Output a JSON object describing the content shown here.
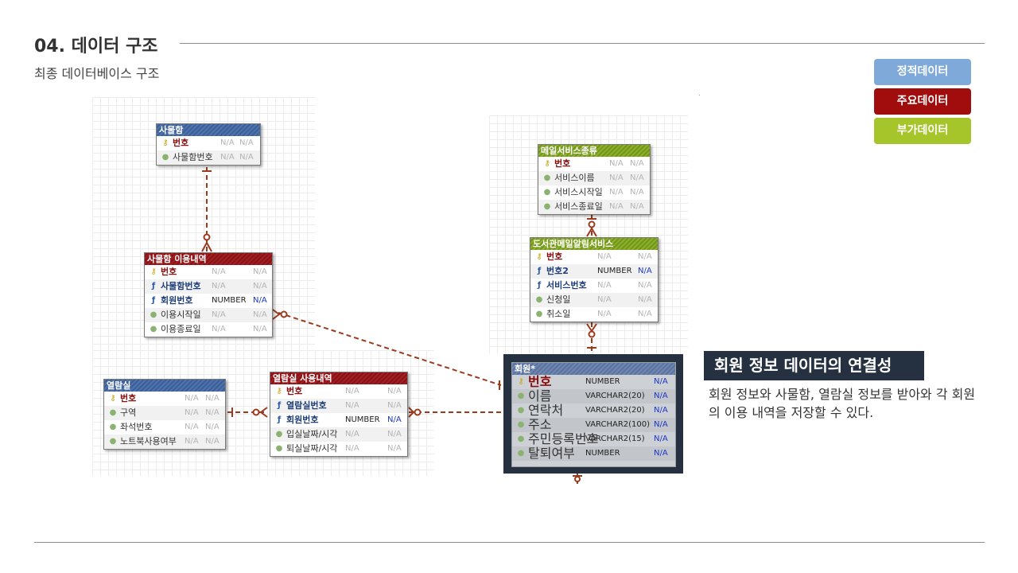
{
  "header": {
    "title": "04. 데이터 구조",
    "subtitle": "최종 데이터베이스 구조"
  },
  "legend": [
    {
      "label": "정적데이터",
      "color": "#7ea9d9"
    },
    {
      "label": "주요데이터",
      "color": "#a10d0d"
    },
    {
      "label": "부가데이터",
      "color": "#a5c52b"
    }
  ],
  "tables": {
    "locker": {
      "name": "사물함",
      "color": "blue",
      "rows": [
        {
          "icon": "key",
          "name": "번호",
          "type": "N/A",
          "null": "N/A"
        },
        {
          "icon": "dot",
          "name": "사물함번호",
          "type": "N/A",
          "null": "N/A"
        }
      ]
    },
    "locker_usage": {
      "name": "사물함 이용내역",
      "color": "red",
      "rows": [
        {
          "icon": "key",
          "name": "번호",
          "type": "N/A",
          "null": "N/A"
        },
        {
          "icon": "fk",
          "name": "사물함번호",
          "type": "N/A",
          "null": "N/A"
        },
        {
          "icon": "fk",
          "name": "회원번호",
          "type": "NUMBER",
          "null": "N/A"
        },
        {
          "icon": "dot",
          "name": "이용시작일",
          "type": "N/A",
          "null": "N/A"
        },
        {
          "icon": "dot",
          "name": "이용종료일",
          "type": "N/A",
          "null": "N/A"
        }
      ]
    },
    "reading_room": {
      "name": "열람실",
      "color": "blue",
      "rows": [
        {
          "icon": "key",
          "name": "번호",
          "type": "N/A",
          "null": "N/A"
        },
        {
          "icon": "dot",
          "name": "구역",
          "type": "N/A",
          "null": "N/A"
        },
        {
          "icon": "dot",
          "name": "좌석번호",
          "type": "N/A",
          "null": "N/A"
        },
        {
          "icon": "dot",
          "name": "노트북사용여부",
          "type": "N/A",
          "null": "N/A"
        }
      ]
    },
    "room_usage": {
      "name": "열람실 사용내역",
      "color": "red",
      "rows": [
        {
          "icon": "key",
          "name": "번호",
          "type": "N/A",
          "null": "N/A"
        },
        {
          "icon": "fk",
          "name": "열람실번호",
          "type": "N/A",
          "null": "N/A"
        },
        {
          "icon": "fk",
          "name": "회원번호",
          "type": "NUMBER",
          "null": "N/A"
        },
        {
          "icon": "dot",
          "name": "입실날짜/시각",
          "type": "N/A",
          "null": "N/A"
        },
        {
          "icon": "dot",
          "name": "퇴실날짜/시각",
          "type": "N/A",
          "null": "N/A"
        }
      ]
    },
    "mail_service_type": {
      "name": "메일서비스종류",
      "color": "green",
      "rows": [
        {
          "icon": "key",
          "name": "번호",
          "type": "N/A",
          "null": "N/A"
        },
        {
          "icon": "dot",
          "name": "서비스이름",
          "type": "N/A",
          "null": "N/A"
        },
        {
          "icon": "dot",
          "name": "서비스시작일",
          "type": "N/A",
          "null": "N/A"
        },
        {
          "icon": "dot",
          "name": "서비스종료일",
          "type": "N/A",
          "null": "N/A"
        }
      ]
    },
    "book_mail_service": {
      "name": "도서관메일알림서비스",
      "color": "green",
      "rows": [
        {
          "icon": "key",
          "name": "번호",
          "type": "N/A",
          "null": "N/A"
        },
        {
          "icon": "fk",
          "name": "번호2",
          "type": "NUMBER",
          "null": "N/A"
        },
        {
          "icon": "fk",
          "name": "서비스번호",
          "type": "N/A",
          "null": "N/A"
        },
        {
          "icon": "dot",
          "name": "신청일",
          "type": "N/A",
          "null": "N/A"
        },
        {
          "icon": "dot",
          "name": "취소일",
          "type": "N/A",
          "null": "N/A"
        }
      ]
    },
    "member": {
      "name": "회원*",
      "color": "blue",
      "rows": [
        {
          "icon": "key",
          "name": "번호",
          "type": "NUMBER",
          "null": "N/A"
        },
        {
          "icon": "dot",
          "name": "이름",
          "type": "VARCHAR2(20)",
          "null": "N/A"
        },
        {
          "icon": "dot",
          "name": "연락처",
          "type": "VARCHAR2(20)",
          "null": "N/A"
        },
        {
          "icon": "dot",
          "name": "주소",
          "type": "VARCHAR2(100)",
          "null": "N/A"
        },
        {
          "icon": "dot",
          "name": "주민등록번호",
          "type": "VARCHAR2(15)",
          "null": "N/A"
        },
        {
          "icon": "dot",
          "name": "탈퇴여부",
          "type": "NUMBER",
          "null": "N/A"
        }
      ]
    }
  },
  "caption": {
    "title": "회원 정보 데이터의 연결성",
    "text": "회원 정보와 사물함, 열람실 정보를 받아와 각 회원의 이용 내역을 저장할 수 있다."
  }
}
